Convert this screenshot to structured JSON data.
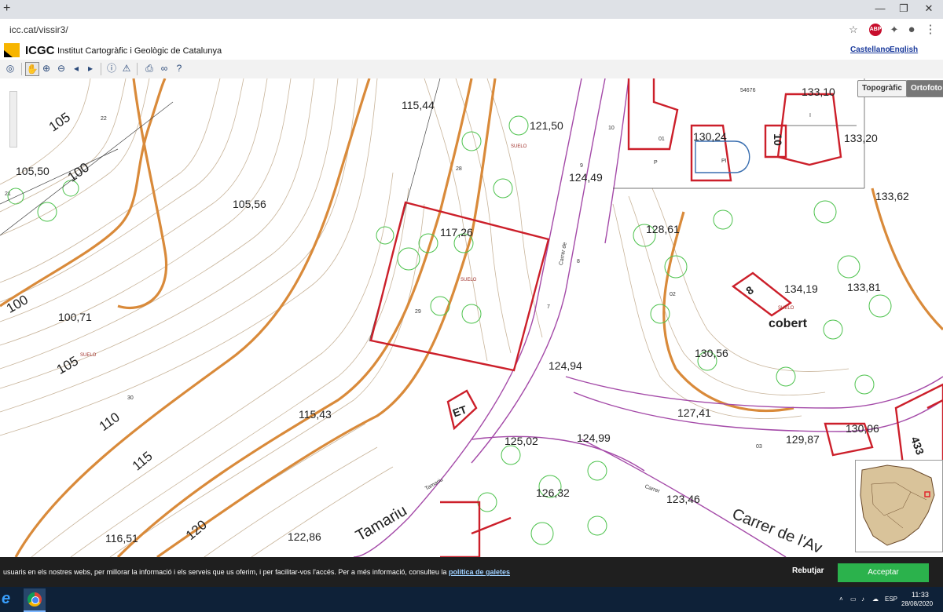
{
  "browser": {
    "url": "icc.cat/vissir3/",
    "new_tab": "+",
    "minimize": "—",
    "restore": "❐",
    "close": "✕"
  },
  "app": {
    "brand": "ICGC",
    "org_name": "Institut Cartogràfic i Geològic de Catalunya",
    "lang_es": "Castellano",
    "lang_en": "English"
  },
  "layers": {
    "topo": "Topogràfic",
    "ortho": "Ortofoto"
  },
  "map": {
    "elevations": [
      "115,44",
      "121,50",
      "133,10",
      "130,24",
      "133,20",
      "124,49",
      "133,62",
      "105,56",
      "117,26",
      "128,61",
      "134,19",
      "133,81",
      "100,71",
      "124,94",
      "130,56",
      "127,41",
      "115,43",
      "125,02",
      "124,99",
      "129,87",
      "130,06",
      "126,32",
      "123,46",
      "116,51",
      "122,86",
      "105,50"
    ],
    "contours": [
      "105",
      "100",
      "100",
      "105",
      "110",
      "115",
      "120"
    ],
    "parcels": [
      "22",
      "21",
      "28",
      "29",
      "30",
      "01",
      "02",
      "03",
      "54676",
      "7",
      "8",
      "9",
      "10",
      "P",
      "PI",
      "I"
    ],
    "building_labels": [
      "8",
      "cobert",
      "ET",
      "433",
      "10"
    ],
    "suelo": "SUELO",
    "streets": [
      "Tamariu",
      "Carrer de l'Av",
      "Carrer de",
      "Carrer",
      "Tamariu"
    ]
  },
  "cookie": {
    "text": "usuaris en els nostres webs, per millorar la informació i els serveis que us oferim, i per facilitar-vos l'accés. Per a més informació, consulteu la",
    "link": "política de galetes",
    "reject": "Rebutjar",
    "accept": "Acceptar"
  },
  "taskbar": {
    "lang": "ESP",
    "time": "11:33",
    "date": "28/08/2020"
  },
  "colors": {
    "contour_major": "#d98a3a",
    "contour_minor": "#c8b49a",
    "parcel_red": "#cc1f2a",
    "vegetation": "#4cc24c",
    "road_purple": "#a44aa8",
    "accept_green": "#2bb24c"
  }
}
